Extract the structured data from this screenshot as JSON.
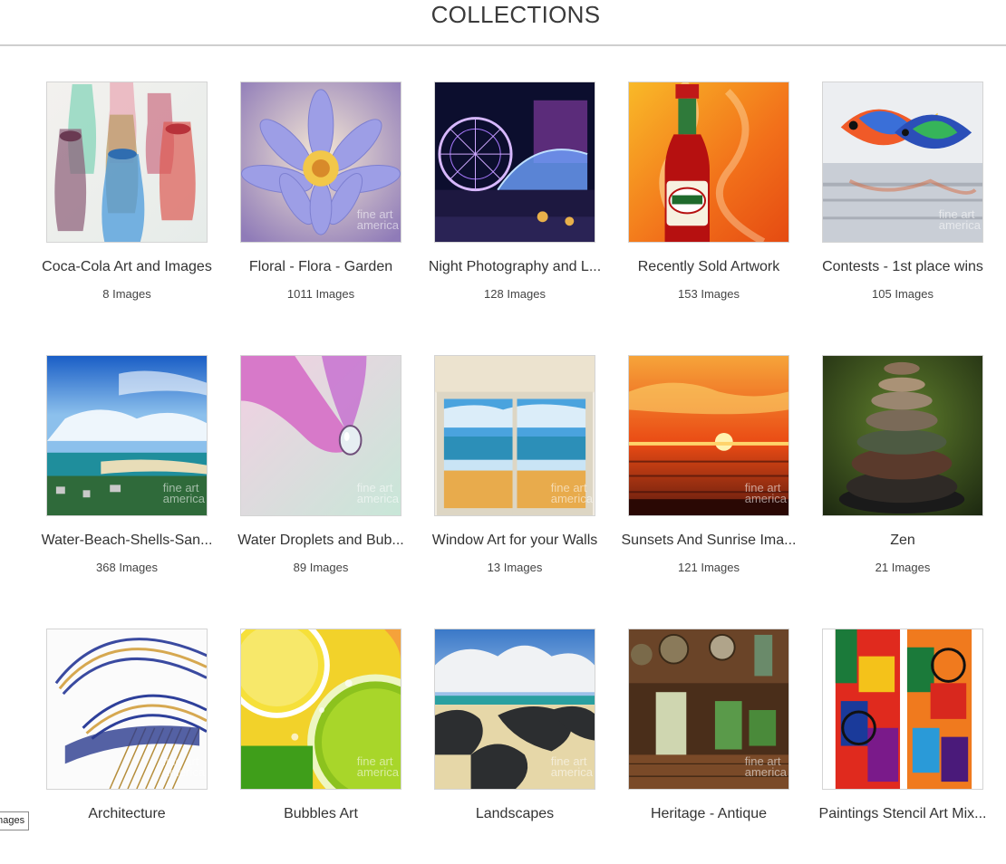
{
  "page": {
    "title": "COLLECTIONS"
  },
  "watermark": {
    "line1": "fine art",
    "line2": "america"
  },
  "tooltip": {
    "text": "Images"
  },
  "collections": [
    {
      "title": "Coca-Cola Art and Images",
      "count": "8 Images"
    },
    {
      "title": "Floral - Flora - Garden",
      "count": "1011 Images"
    },
    {
      "title": "Night Photography and L...",
      "count": "128 Images"
    },
    {
      "title": "Recently Sold Artwork",
      "count": "153 Images"
    },
    {
      "title": "Contests - 1st place wins",
      "count": "105 Images"
    },
    {
      "title": "Water-Beach-Shells-San...",
      "count": "368 Images"
    },
    {
      "title": "Water Droplets and Bub...",
      "count": "89 Images"
    },
    {
      "title": "Window Art for your Walls",
      "count": "13 Images"
    },
    {
      "title": "Sunsets And Sunrise Ima...",
      "count": "121 Images"
    },
    {
      "title": "Zen",
      "count": "21 Images"
    },
    {
      "title": "Architecture",
      "count": ""
    },
    {
      "title": "Bubbles Art",
      "count": ""
    },
    {
      "title": "Landscapes",
      "count": ""
    },
    {
      "title": "Heritage - Antique",
      "count": ""
    },
    {
      "title": "Paintings Stencil Art Mix...",
      "count": ""
    }
  ]
}
